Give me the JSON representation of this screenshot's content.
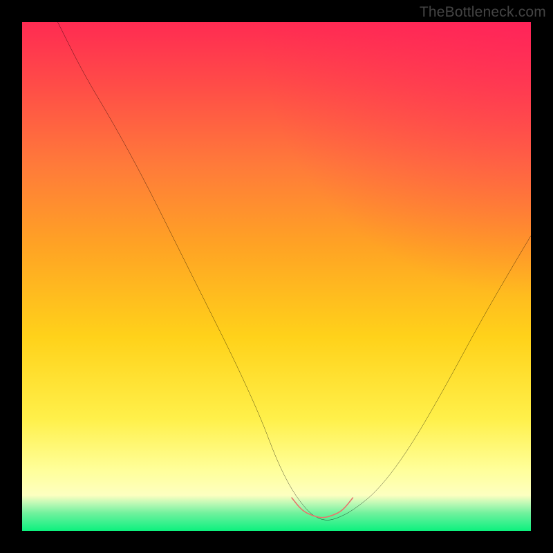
{
  "watermark": "TheBottleneck.com",
  "colors": {
    "frame_background": "#000000",
    "curve_stroke": "#000000",
    "trough_highlight": "#e9736b",
    "gradient_top": "#ff2b52",
    "gradient_mid": "#ffd21a",
    "gradient_bottom_band": "#00e66e"
  },
  "chart_data": {
    "type": "line",
    "title": "",
    "xlabel": "",
    "ylabel": "",
    "xlim": [
      0,
      100
    ],
    "ylim": [
      0,
      100
    ],
    "grid": false,
    "legend": false,
    "series": [
      {
        "name": "bottleneck-curve",
        "x": [
          7,
          12,
          18,
          24,
          30,
          36,
          42,
          47,
          50,
          53,
          56,
          58,
          60,
          62,
          65,
          70,
          76,
          83,
          90,
          97,
          100
        ],
        "y": [
          100,
          90,
          80,
          69,
          57,
          45,
          33,
          22,
          14,
          8,
          4,
          2.5,
          2,
          2.5,
          4,
          8,
          16,
          28,
          41,
          53,
          58
        ]
      },
      {
        "name": "trough-highlight",
        "x": [
          53,
          55,
          57,
          59,
          61,
          63,
          65
        ],
        "y": [
          6.5,
          4,
          3,
          2.5,
          3,
          4,
          6.5
        ]
      }
    ],
    "annotations": [
      {
        "text": "TheBottleneck.com",
        "position": "top-right"
      }
    ]
  }
}
